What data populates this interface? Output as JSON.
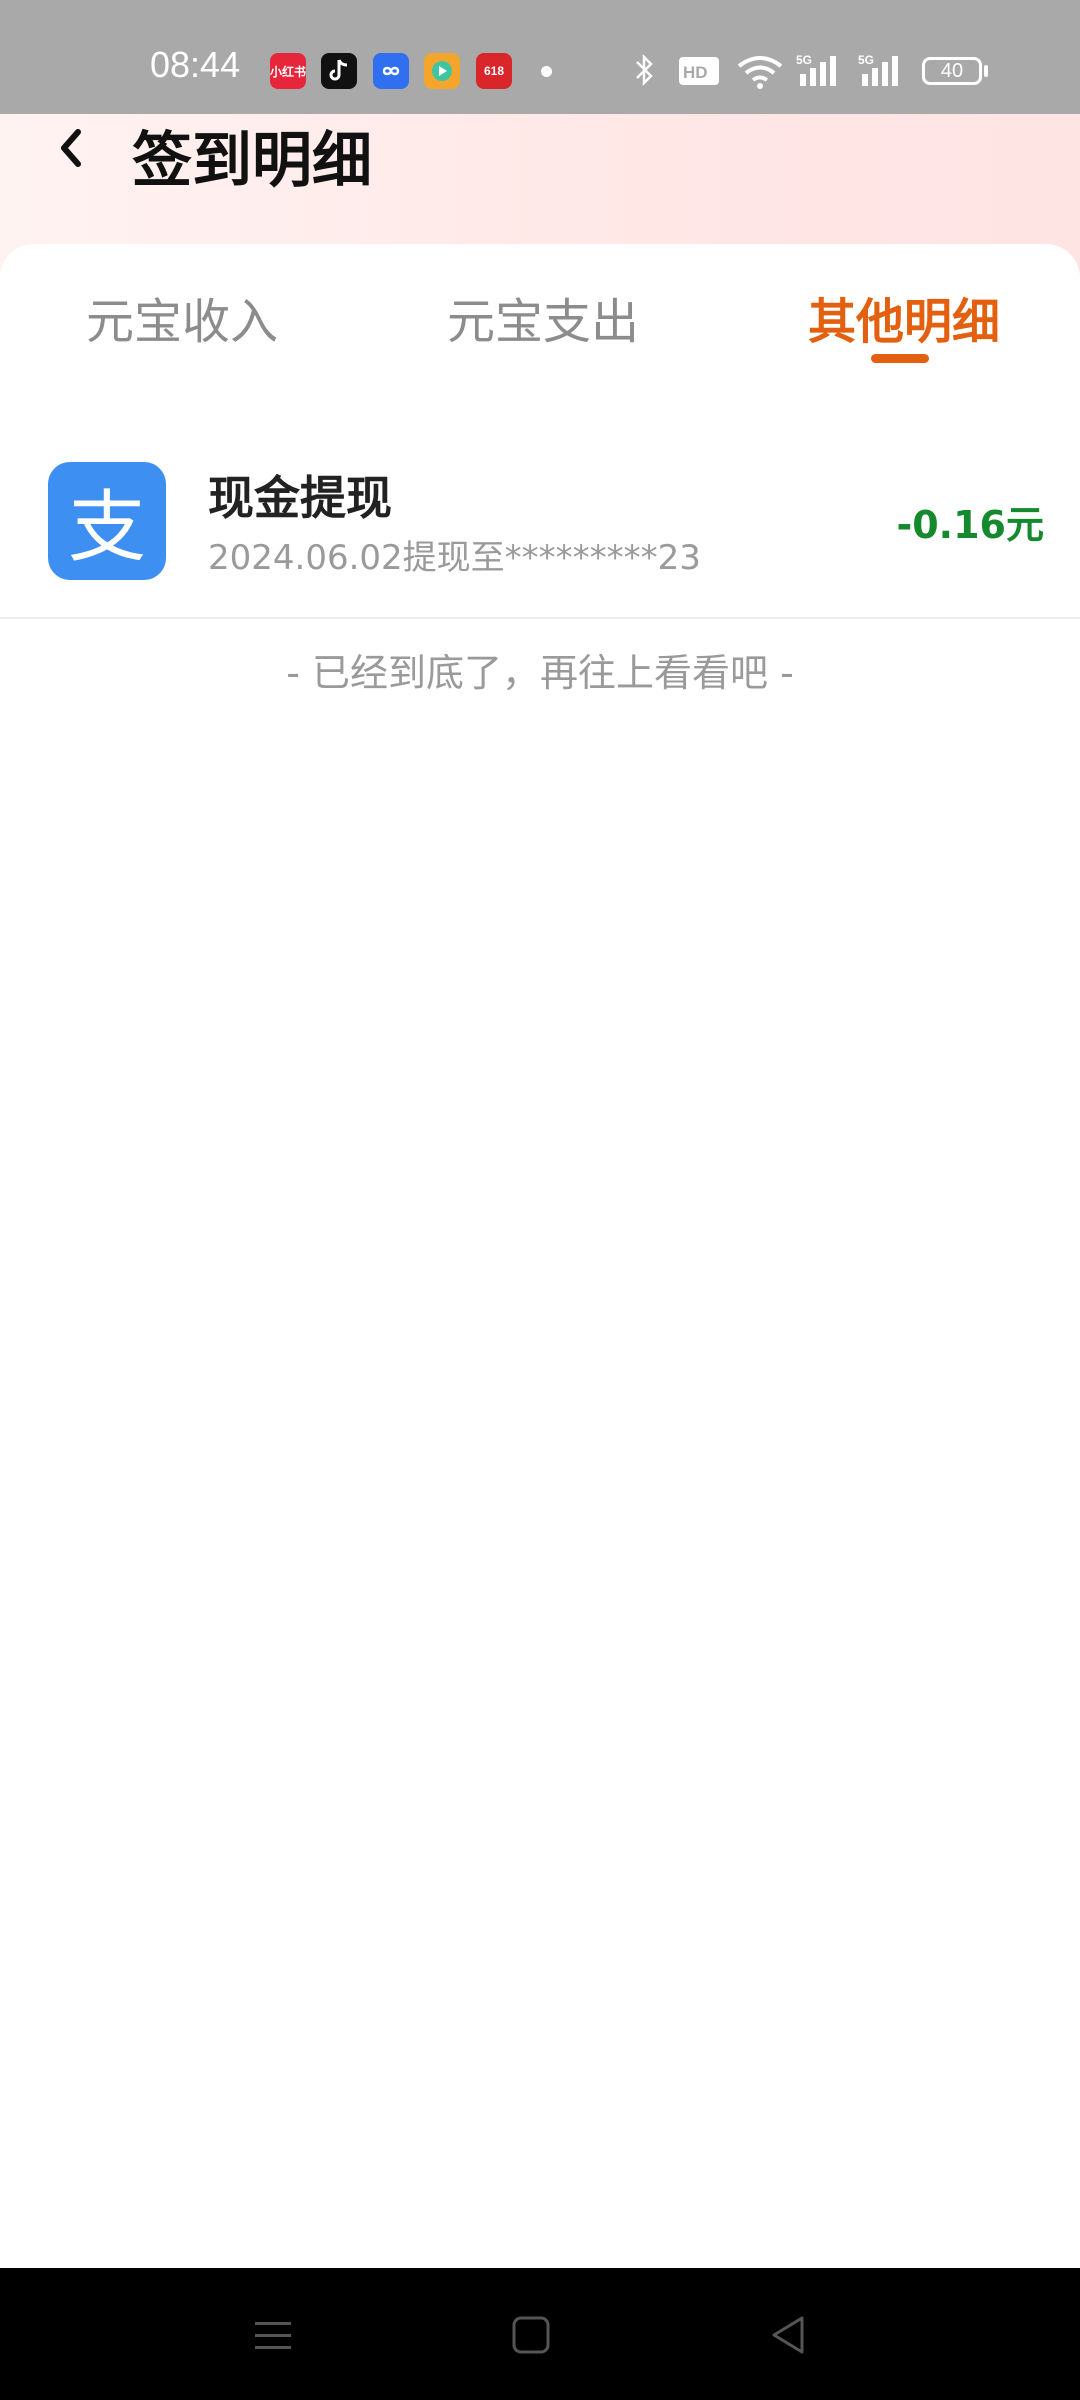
{
  "status_bar": {
    "time": "08:44",
    "app_icons": [
      {
        "name": "xiaohongshu-icon",
        "label": "小红书",
        "color": "#e8263b"
      },
      {
        "name": "tiktok-icon",
        "label": "",
        "color": "#111111"
      },
      {
        "name": "infinity-app-icon",
        "label": "",
        "color": "#2f6ff0"
      },
      {
        "name": "video-app-icon",
        "label": "",
        "color": "#f4a62c"
      },
      {
        "name": "shopping-618-icon",
        "label": "618",
        "color": "#d8262b"
      }
    ],
    "battery": "40"
  },
  "header": {
    "title": "签到明细"
  },
  "tabs": [
    {
      "label": "元宝收入",
      "active": false
    },
    {
      "label": "元宝支出",
      "active": false
    },
    {
      "label": "其他明细",
      "active": true
    }
  ],
  "records": [
    {
      "icon": "alipay-icon",
      "icon_glyph": "支",
      "title": "现金提现",
      "subtitle": "2024.06.02提现至*********23",
      "amount": "-0.16元"
    }
  ],
  "end_hint": "- 已经到底了，再往上看看吧 -",
  "colors": {
    "accent": "#e2600f",
    "amount_negative": "#15892e",
    "alipay_blue": "#3d8ff2"
  }
}
